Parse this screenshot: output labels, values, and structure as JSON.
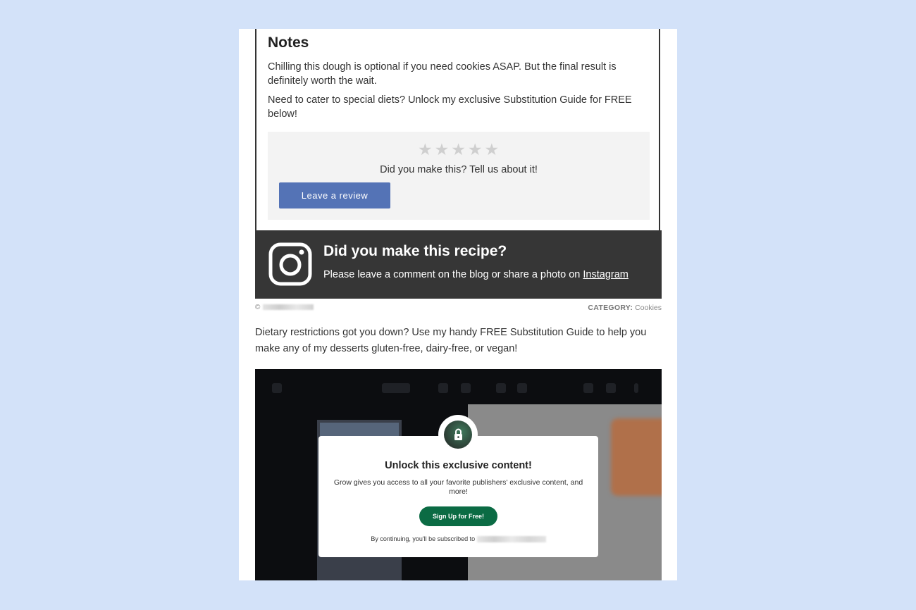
{
  "notes": {
    "title": "Notes",
    "paragraphs": [
      "Chilling this dough is optional if you need cookies ASAP. But the final result is definitely worth the wait.",
      "Need to cater to special diets? Unlock my exclusive Substitution Guide for FREE below!"
    ]
  },
  "review": {
    "stars": [
      "★",
      "★",
      "★",
      "★",
      "★"
    ],
    "rating": 0,
    "prompt": "Did you make this? Tell us about it!",
    "button_label": "Leave a review"
  },
  "instagram": {
    "icon": "instagram-icon",
    "title": "Did you make this recipe?",
    "text": "Please leave a comment on the blog or share a photo on ",
    "link_label": "Instagram"
  },
  "footer": {
    "copyright_symbol": "©",
    "category_label": "CATEGORY:",
    "category_value": "Cookies"
  },
  "intro_text": "Dietary restrictions got you down? Use my handy FREE Substitution Guide to help you make any of my desserts gluten-free, dairy-free, or vegan!",
  "unlock_modal": {
    "icon": "lock-icon",
    "title": "Unlock this exclusive content!",
    "description": "Grow gives you access to all your favorite publishers' exclusive content, and more!",
    "button_label": "Sign Up for Free!",
    "footnote": "By continuing, you'll be subscribed to "
  },
  "colors": {
    "background": "#d3e2f9",
    "review_button": "#5473b6",
    "instagram_bar": "#363636",
    "signup_button": "#0b6b44"
  }
}
